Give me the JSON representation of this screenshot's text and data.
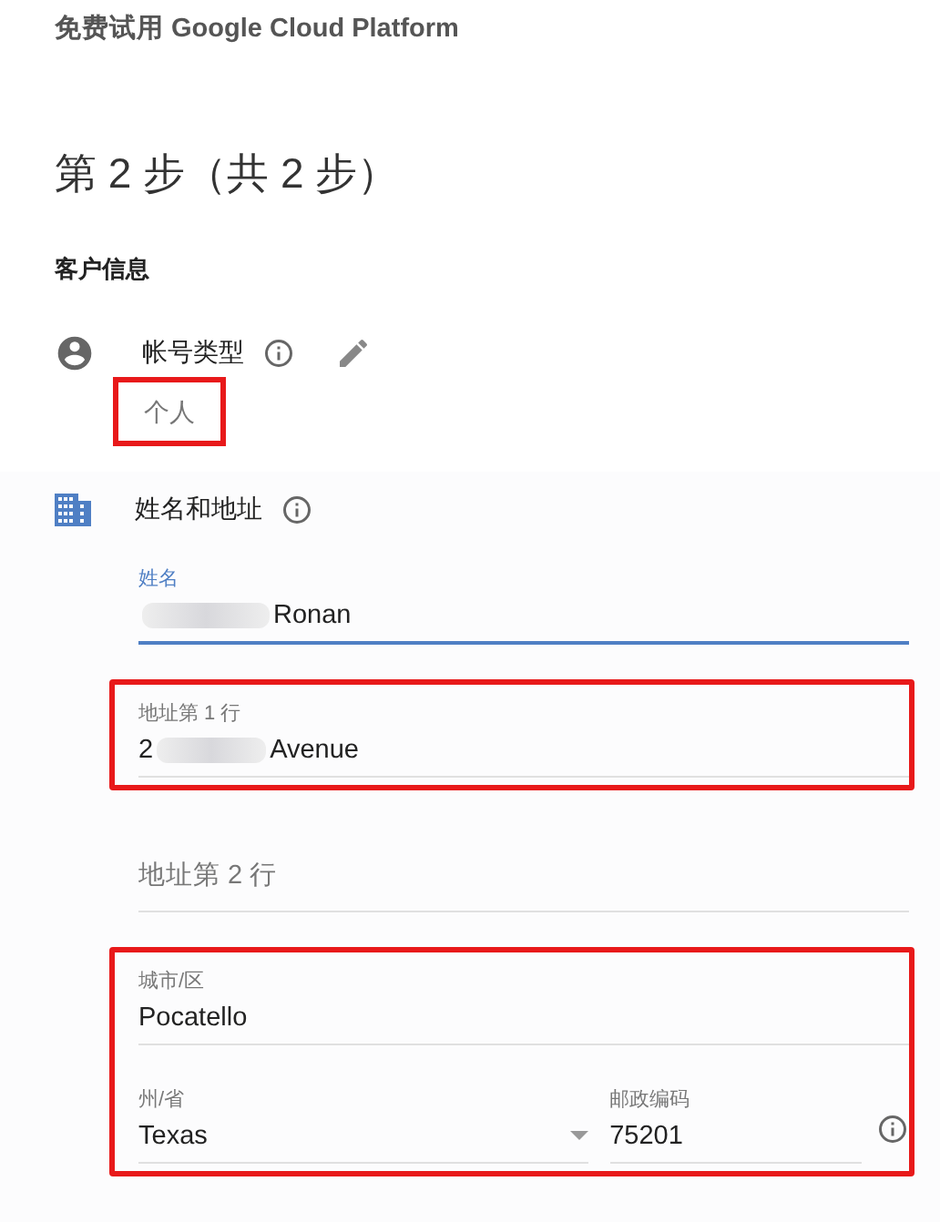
{
  "header": {
    "title": "免费试用 Google Cloud Platform"
  },
  "step_title": "第 2 步（共 2 步）",
  "section_title": "客户信息",
  "account_type": {
    "label": "帐号类型",
    "value": "个人",
    "highlighted": true
  },
  "name_address": {
    "label": "姓名和地址",
    "groups": [
      {
        "highlighted": false,
        "rows": [
          [
            {
              "kind": "text",
              "label": "姓名",
              "value": [
                "Ronan"
              ],
              "redacted_lead": true,
              "focused": true
            }
          ]
        ]
      },
      {
        "highlighted": true,
        "rows": [
          [
            {
              "kind": "text",
              "label": "地址第 1 行",
              "value": [
                "2",
                "Avenue"
              ],
              "redacted_lead": false,
              "focused": false
            }
          ]
        ]
      },
      {
        "highlighted": false,
        "rows": [
          [
            {
              "kind": "text",
              "placeholder": "地址第 2 行",
              "focused": false
            }
          ]
        ]
      },
      {
        "highlighted": true,
        "rows": [
          [
            {
              "kind": "text",
              "label": "城市/区",
              "value": [
                "Pocatello"
              ],
              "redacted_lead": false,
              "focused": false
            }
          ],
          [
            {
              "kind": "select",
              "label": "州/省",
              "value": [
                "Texas"
              ],
              "redacted_lead": false,
              "focused": false
            },
            {
              "kind": "text",
              "label": "邮政编码",
              "value": [
                "75201"
              ],
              "redacted_lead": false,
              "focused": false,
              "info": true
            }
          ]
        ]
      }
    ]
  }
}
